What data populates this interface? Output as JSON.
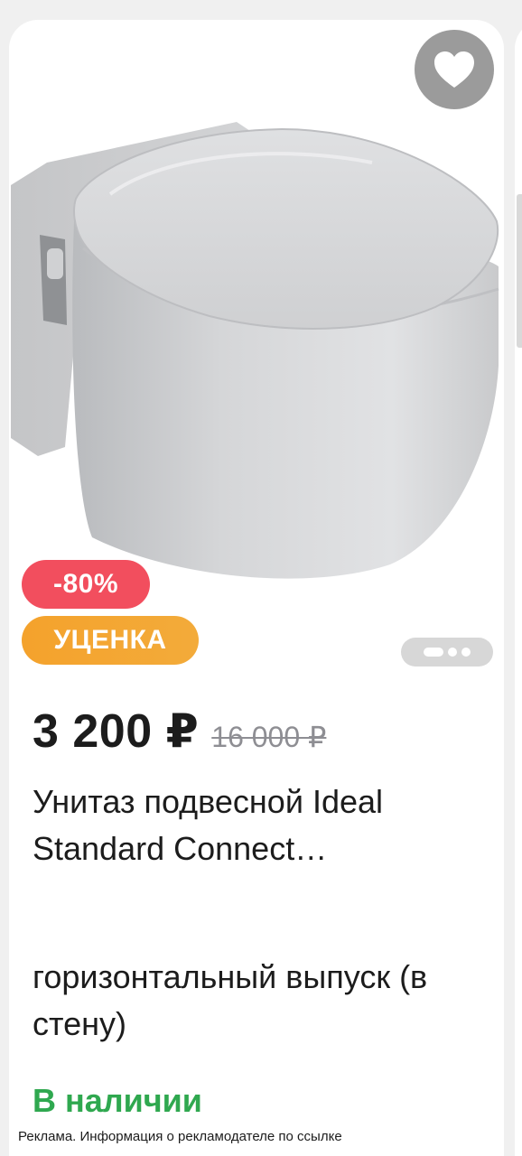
{
  "product": {
    "badges": {
      "discount": "-80%",
      "markdown": "УЦЕНКА"
    },
    "price": {
      "current": "3 200 ₽",
      "old": "16 000 ₽"
    },
    "title": "Унитаз подвесной Ideal Standard Connect…",
    "subtitle": "горизонтальный выпуск (в стену)",
    "availability": "В наличии",
    "image_pager": {
      "total": 3,
      "active_index": 0
    }
  },
  "icons": {
    "favorite": "heart-icon"
  },
  "colors": {
    "discount_badge": "#f24e5e",
    "markdown_badge": "#f4a22c",
    "availability_text": "#2fa84f",
    "favorite_button": "#9b9b9b"
  },
  "ad_disclaimer": "Реклама. Информация о рекламодателе по ссылке"
}
